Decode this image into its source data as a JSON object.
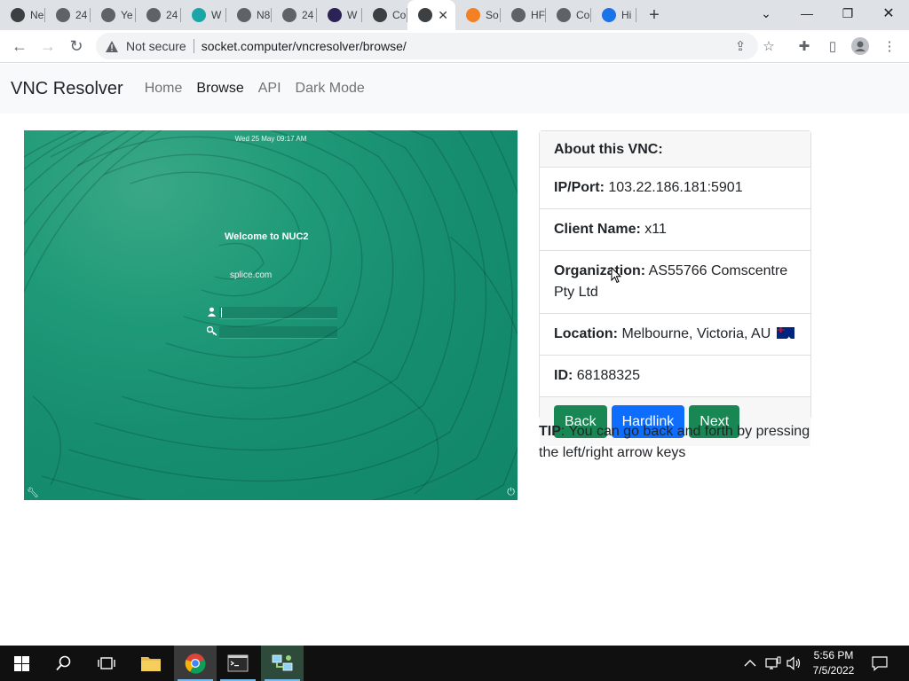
{
  "browser": {
    "tabs": [
      {
        "title": "Ne",
        "favicon": "github-icon",
        "color": "#3c4043"
      },
      {
        "title": "24",
        "favicon": "globe-icon",
        "color": "#5f6368"
      },
      {
        "title": "Ye",
        "favicon": "globe-icon",
        "color": "#5f6368"
      },
      {
        "title": "24",
        "favicon": "globe-icon",
        "color": "#5f6368"
      },
      {
        "title": "W",
        "favicon": "wyzant-icon",
        "color": "#1aa6a6"
      },
      {
        "title": "N8",
        "favicon": "globe-icon",
        "color": "#5f6368"
      },
      {
        "title": "24",
        "favicon": "globe-icon",
        "color": "#5f6368"
      },
      {
        "title": "W",
        "favicon": "eclipse-icon",
        "color": "#2c2255"
      },
      {
        "title": "Co",
        "favicon": "helmet-icon",
        "color": "#3c4043"
      },
      {
        "title": "",
        "favicon": "helmet-icon",
        "color": "#3c4043",
        "active": true
      },
      {
        "title": "So",
        "favicon": "swoosh-icon",
        "color": "#f48024"
      },
      {
        "title": "HF",
        "favicon": "globe-icon",
        "color": "#5f6368"
      },
      {
        "title": "Co",
        "favicon": "globe-icon",
        "color": "#5f6368"
      },
      {
        "title": "Hi",
        "favicon": "history-icon",
        "color": "#1a73e8"
      }
    ],
    "security_label": "Not secure",
    "url": "socket.computer/vncresolver/browse/"
  },
  "site": {
    "brand": "VNC Resolver",
    "nav": [
      "Home",
      "Browse",
      "API",
      "Dark Mode"
    ]
  },
  "vnc": {
    "datetime": "Wed 25 May 09:17 AM",
    "welcome": "Welcome to NUC2",
    "domain": "splice.com"
  },
  "info": {
    "header": "About this VNC:",
    "ip_label": "IP/Port:",
    "ip_value": "103.22.186.181:5901",
    "client_label": "Client Name:",
    "client_value": "x11",
    "org_label": "Organization:",
    "org_value": "AS55766 Comscentre Pty Ltd",
    "loc_label": "Location:",
    "loc_value": "Melbourne, Victoria, AU",
    "id_label": "ID:",
    "id_value": "68188325",
    "buttons": {
      "back": "Back",
      "hardlink": "Hardlink",
      "next": "Next"
    }
  },
  "tip": {
    "label": "TIP",
    "text": ": You can go back and forth by pressing the left/right arrow keys"
  },
  "taskbar": {
    "time": "5:56 PM",
    "date": "7/5/2022"
  }
}
